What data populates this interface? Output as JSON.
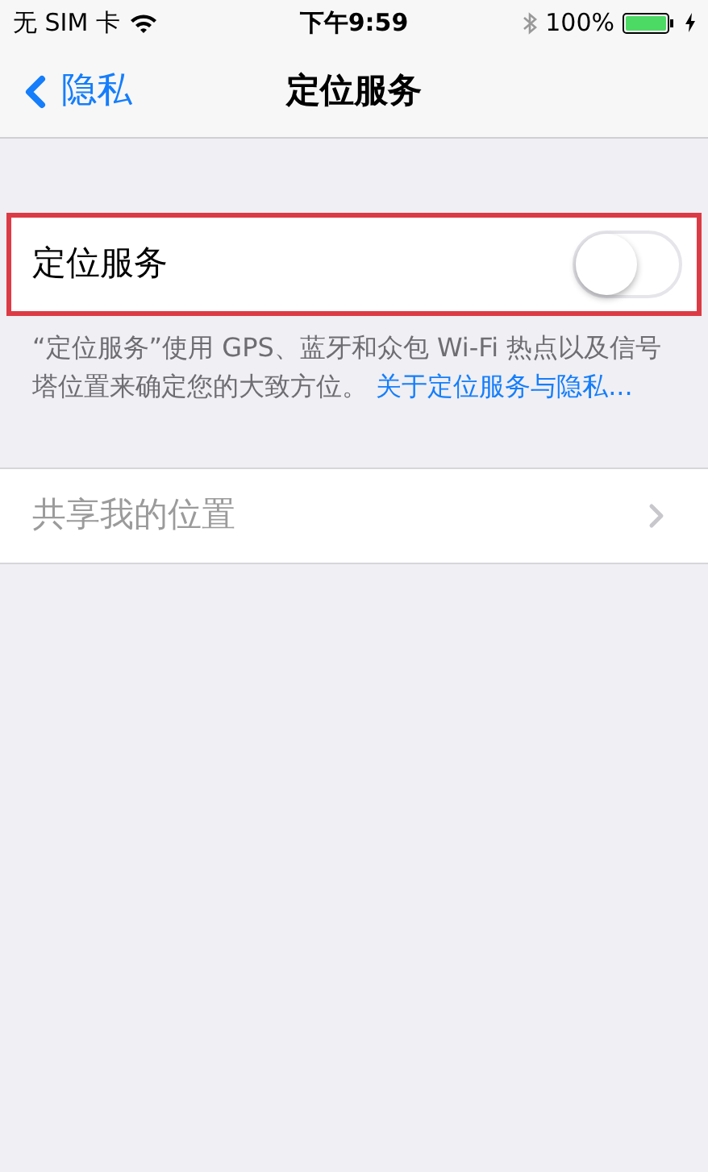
{
  "status_bar": {
    "carrier": "无 SIM 卡",
    "time": "下午9:59",
    "battery": "100%",
    "bluetooth": true,
    "charging": true
  },
  "nav": {
    "back": "隐私",
    "title": "定位服务"
  },
  "location_row": {
    "label": "定位服务",
    "on": false,
    "highlighted": true
  },
  "footer": {
    "text": "“定位服务”使用 GPS、蓝牙和众包 Wi-Fi 热点以及信号塔位置来确定您的大致方位。",
    "link": "关于定位服务与隐私..."
  },
  "share_row": {
    "label": "共享我的位置",
    "disabled": true
  }
}
